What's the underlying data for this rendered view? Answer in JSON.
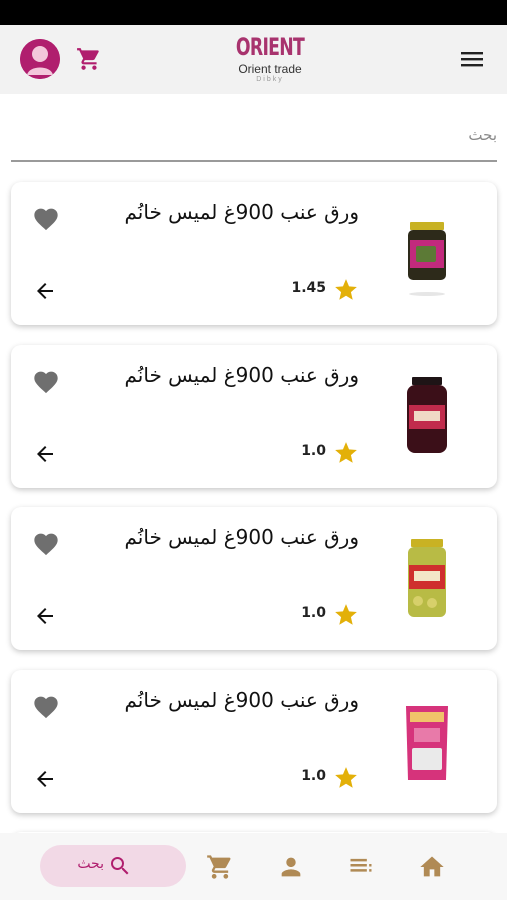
{
  "header": {
    "logo_mark": "ORIENT",
    "logo_subtitle": "Orient trade",
    "logo_tagline": "Dibky",
    "avatar_icon": "user-avatar-icon",
    "cart_icon": "cart-icon",
    "menu_icon": "hamburger-menu-icon"
  },
  "search": {
    "placeholder": "بحث"
  },
  "products": [
    {
      "title": "ورق عنب 900غ لميس خانُم",
      "rating": "1.45"
    },
    {
      "title": "ورق عنب 900غ لميس خانُم",
      "rating": "1.0"
    },
    {
      "title": "ورق عنب 900غ لميس خانُم",
      "rating": "1.0"
    },
    {
      "title": "ورق عنب 900غ لميس خانُم",
      "rating": "1.0"
    }
  ],
  "bottom_nav": {
    "search_label": "بحث",
    "items": [
      "search-icon",
      "cart-icon",
      "person-icon",
      "list-icon",
      "home-icon"
    ]
  },
  "colors": {
    "brand": "#b01e6e",
    "nav_accent": "#b08a55",
    "star": "#e3b009",
    "pill_bg": "#f2d9e6"
  }
}
